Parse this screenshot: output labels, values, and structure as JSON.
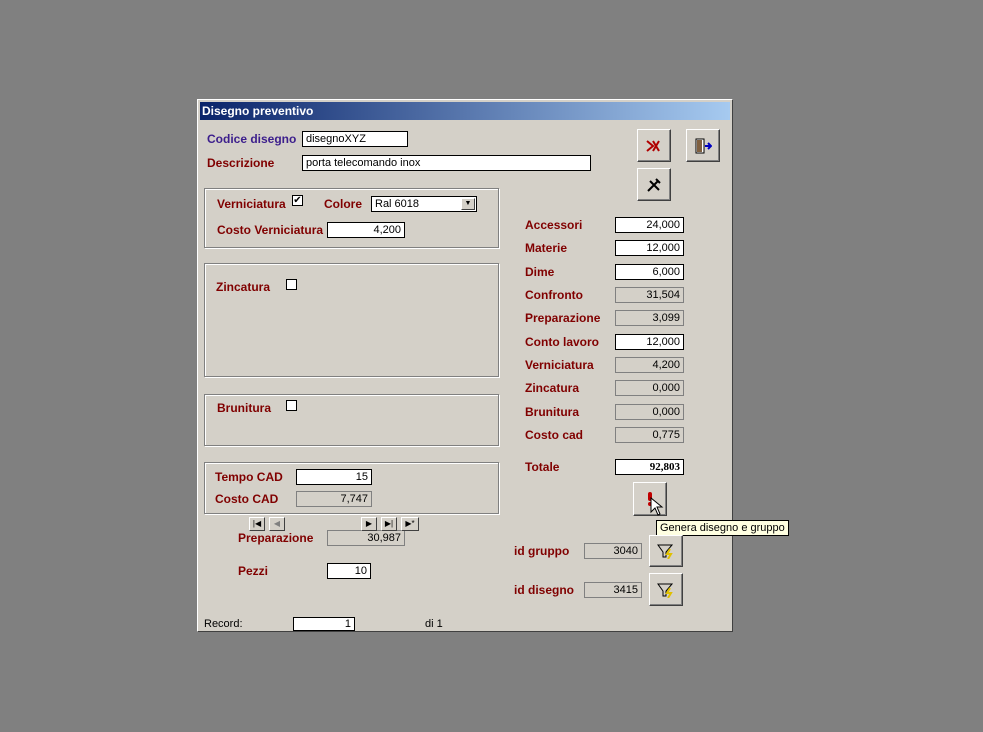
{
  "window": {
    "title": "Disegno preventivo"
  },
  "header": {
    "codice_label": "Codice disegno",
    "codice_value": "disegnoXYZ",
    "descrizione_label": "Descrizione",
    "descrizione_value": "porta telecomando inox"
  },
  "verniciatura": {
    "label": "Verniciatura",
    "checked": "✔",
    "colore_label": "Colore",
    "colore_value": "Ral 6018",
    "costo_label": "Costo Verniciatura",
    "costo_value": "4,200"
  },
  "zincatura": {
    "label": "Zincatura"
  },
  "brunitura": {
    "label": "Brunitura"
  },
  "cad": {
    "tempo_label": "Tempo CAD",
    "tempo_value": "15",
    "costo_label": "Costo CAD",
    "costo_value": "7,747"
  },
  "preparazione": {
    "label": "Preparazione",
    "value": "30,987"
  },
  "pezzi": {
    "label": "Pezzi",
    "value": "10"
  },
  "costs": [
    {
      "label": "Accessori",
      "value": "24,000",
      "editable": true
    },
    {
      "label": "Materie",
      "value": "12,000",
      "editable": true
    },
    {
      "label": "Dime",
      "value": "6,000",
      "editable": true
    },
    {
      "label": "Confronto",
      "value": "31,504",
      "editable": false
    },
    {
      "label": "Preparazione",
      "value": "3,099",
      "editable": false
    },
    {
      "label": "Conto lavoro",
      "value": "12,000",
      "editable": true
    },
    {
      "label": "Verniciatura",
      "value": "4,200",
      "editable": false
    },
    {
      "label": "Zincatura",
      "value": "0,000",
      "editable": false
    },
    {
      "label": "Brunitura",
      "value": "0,000",
      "editable": false
    },
    {
      "label": "Costo cad",
      "value": "0,775",
      "editable": false
    }
  ],
  "totale": {
    "label": "Totale",
    "value": "92,803"
  },
  "ids": {
    "gruppo_label": "id gruppo",
    "gruppo_value": "3040",
    "disegno_label": "id disegno",
    "disegno_value": "3415"
  },
  "tooltip": "Genera disegno e gruppo",
  "record_nav": {
    "label": "Record:",
    "current": "1",
    "of_text": "di 1"
  },
  "colors": {
    "label_red": "#800000",
    "label_blue": "#3c1e8c",
    "title_bar": "#0a246a"
  }
}
